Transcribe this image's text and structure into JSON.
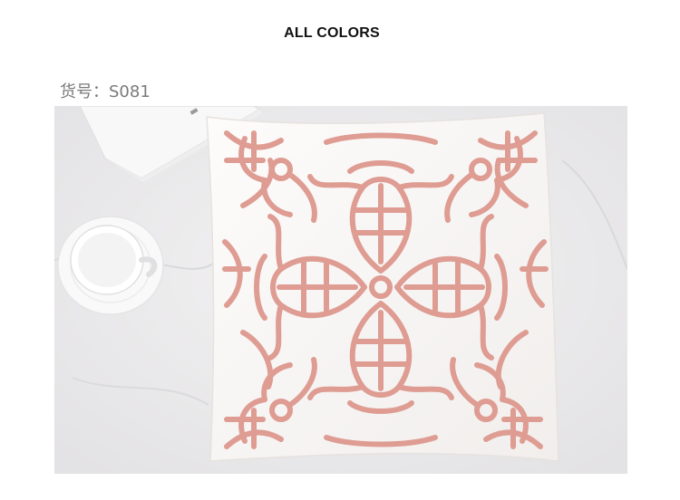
{
  "header": {
    "title": "ALL COLORS"
  },
  "product": {
    "sku_label": "货号：S081"
  },
  "photo": {
    "subject": "pillow",
    "colors": {
      "background": "#ecebec",
      "pillow": "#fbf9f8",
      "embroidery": "#de9c92",
      "cup": "#f7f7f6"
    }
  }
}
